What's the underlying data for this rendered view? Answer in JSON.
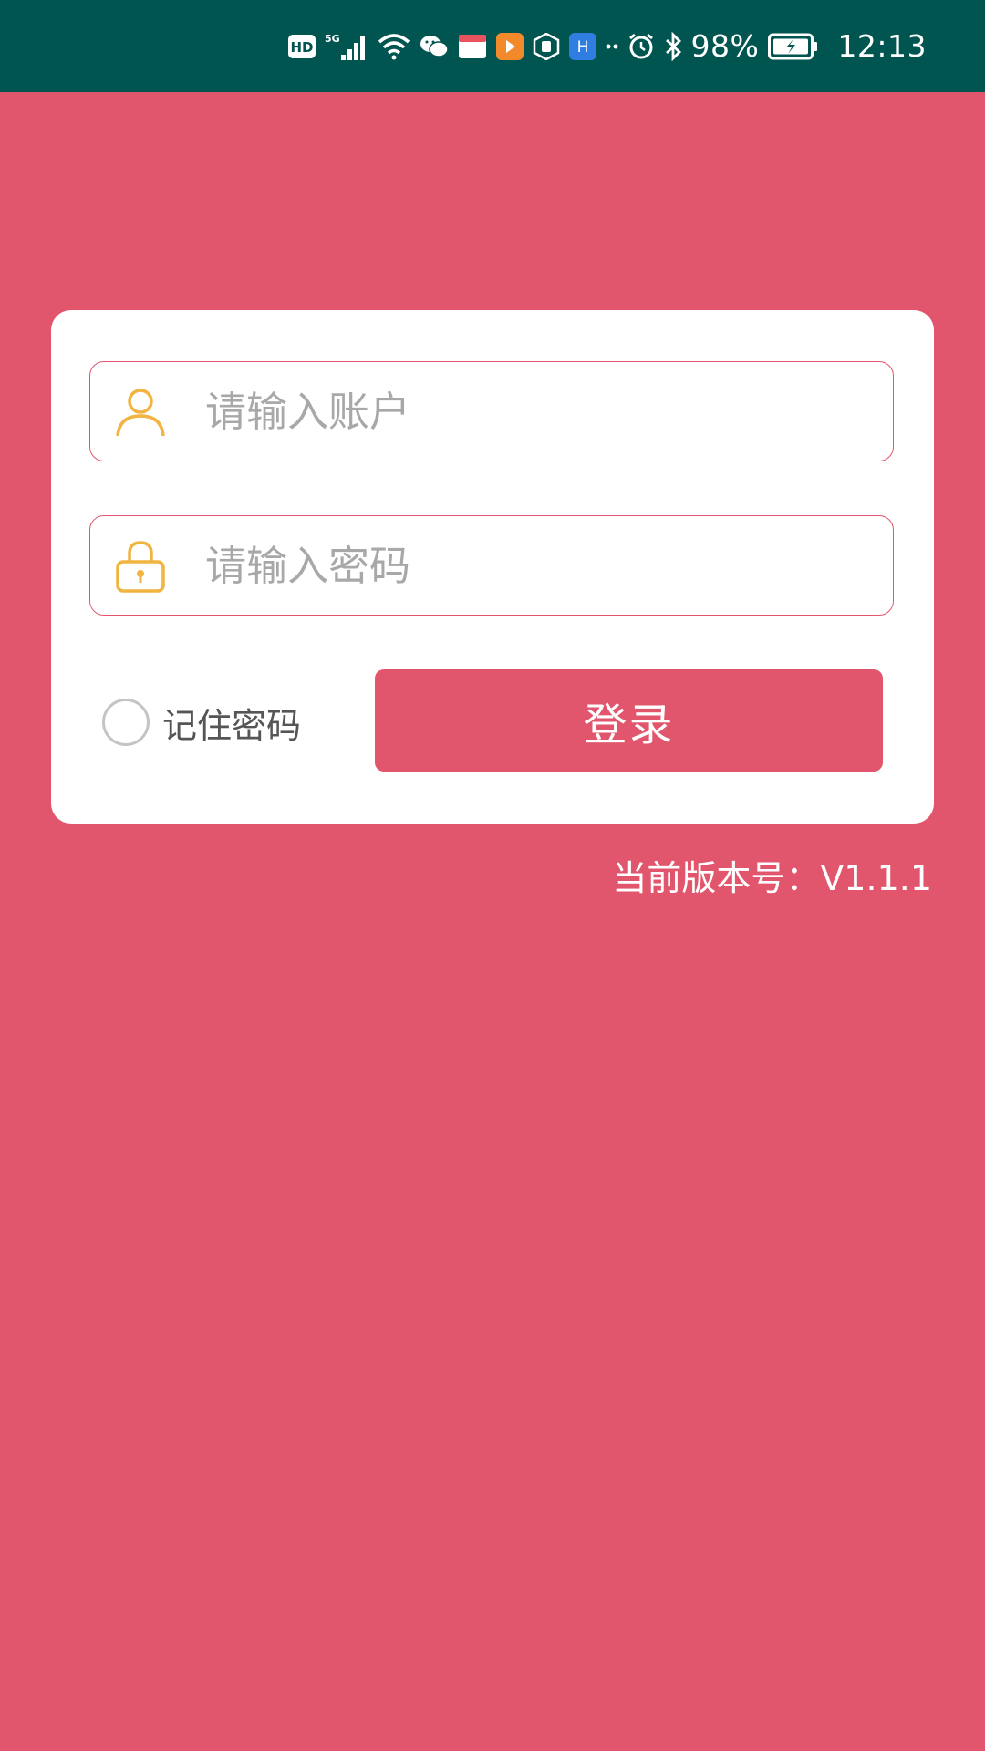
{
  "status_bar": {
    "network_badge": "HD",
    "signal_label": "5G",
    "battery": "98%",
    "time": "12:13",
    "icons": [
      "hd-icon",
      "signal-5g-icon",
      "wifi-icon",
      "wechat-icon",
      "app-box-icon",
      "video-app-icon",
      "hand-app-icon",
      "blue-app-icon",
      "more-dots-icon",
      "alarm-icon",
      "bluetooth-icon",
      "battery-charging-icon"
    ]
  },
  "login": {
    "account_placeholder": "请输入账户",
    "password_placeholder": "请输入密码",
    "remember_label": "记住密码",
    "remember_checked": false,
    "login_button": "登录",
    "version_text": "当前版本号：V1.1.1"
  },
  "colors": {
    "background": "#e1566d",
    "status_bar": "#005550",
    "card": "#ffffff",
    "icon_accent": "#f2b441",
    "placeholder": "#a8a8a8"
  }
}
